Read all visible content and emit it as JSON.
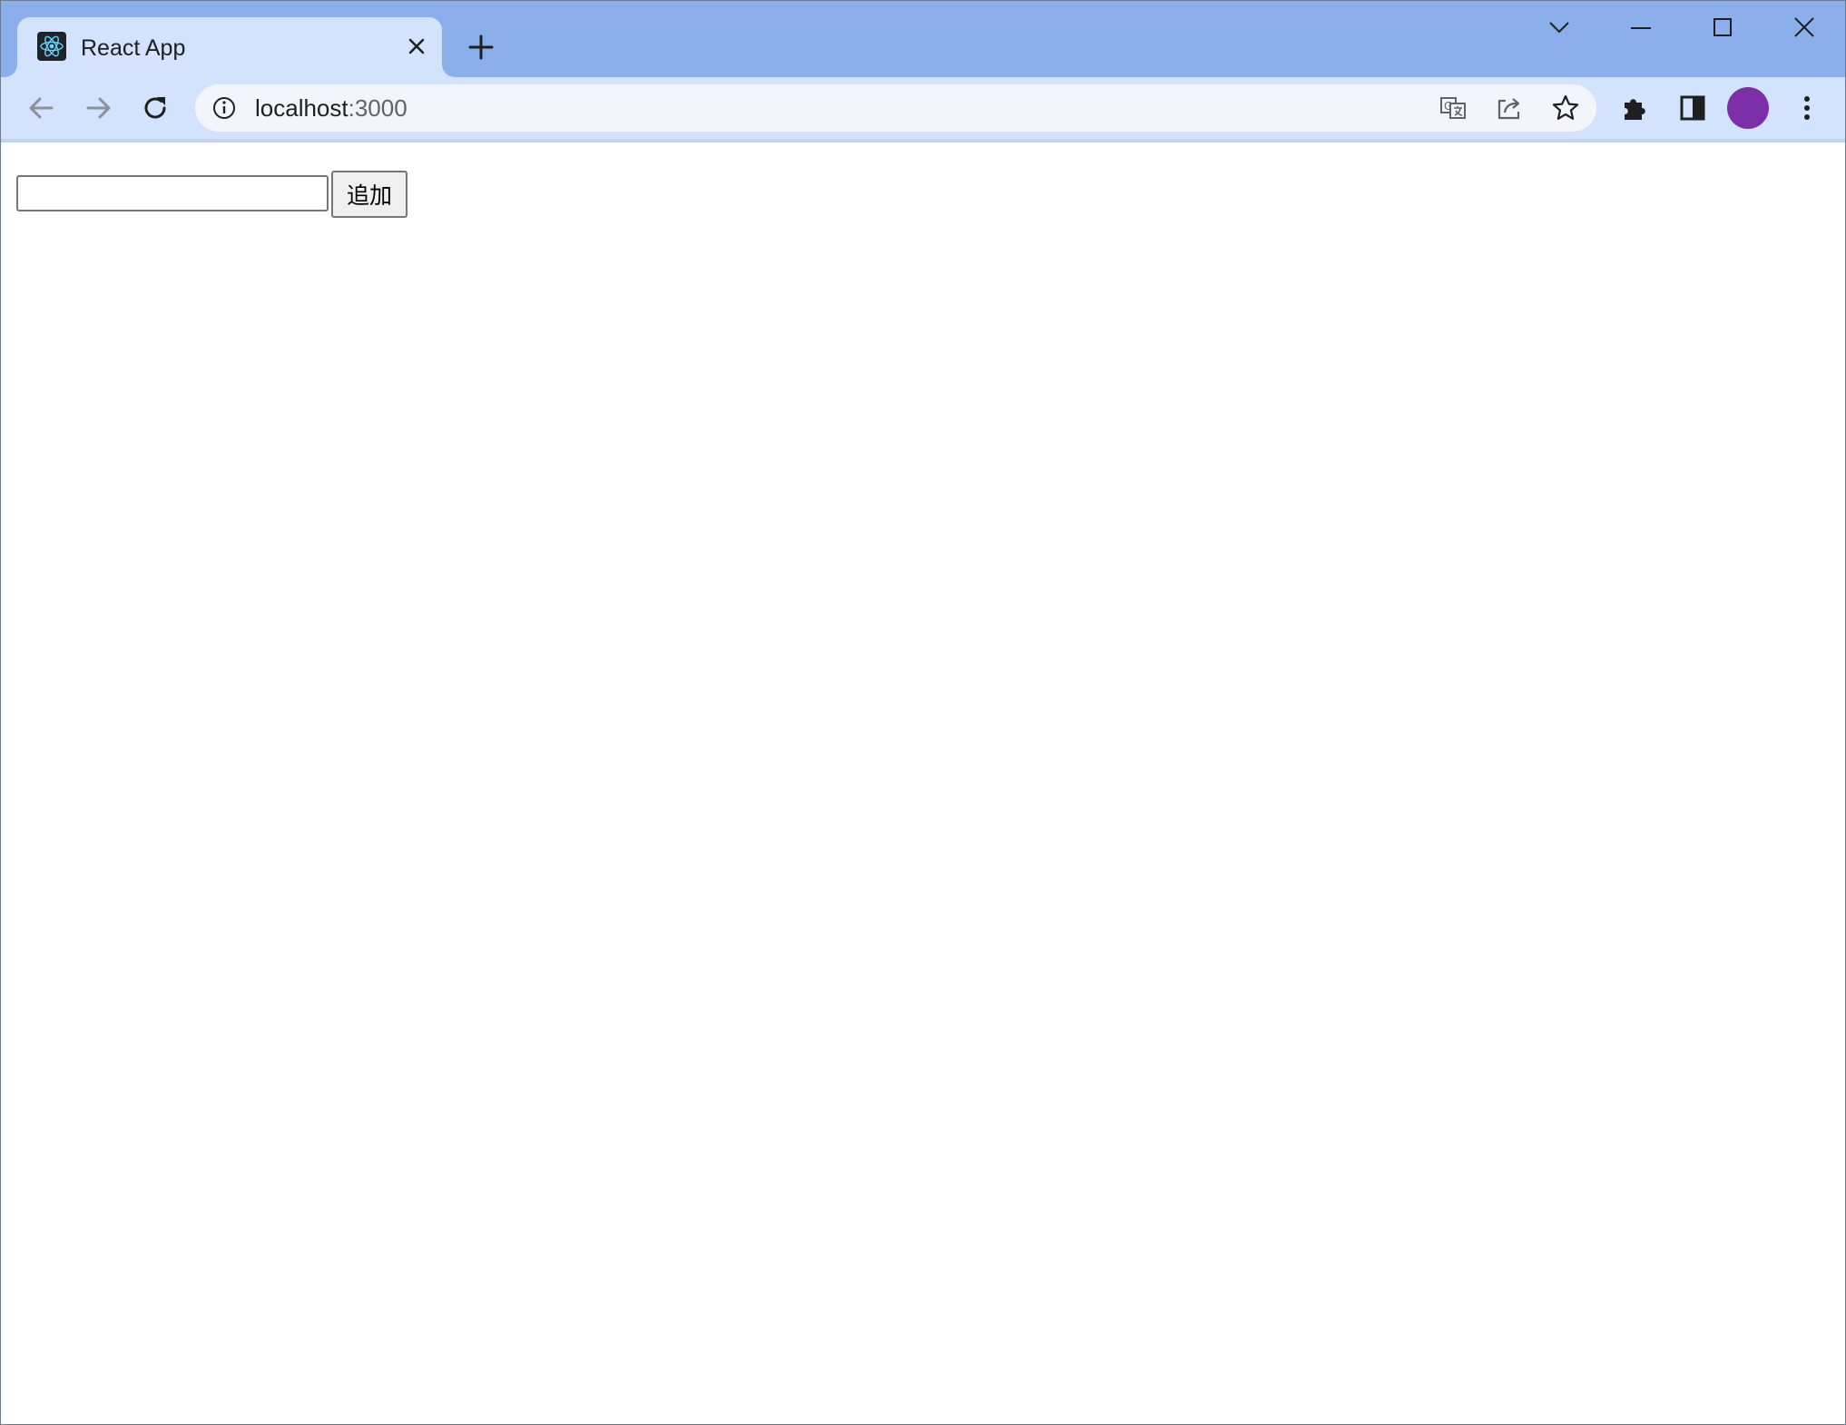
{
  "browser": {
    "tab": {
      "title": "React App",
      "favicon": "react-logo-icon"
    },
    "address_bar": {
      "host": "localhost",
      "port": ":3000"
    },
    "colors": {
      "tabstrip": "#8aafea",
      "active_tab": "#d3e3fd",
      "omnibox": "#f2f6fc",
      "avatar": "#7b2fa8"
    }
  },
  "page": {
    "todo_input": {
      "value": "",
      "placeholder": ""
    },
    "add_button_label": "追加"
  }
}
